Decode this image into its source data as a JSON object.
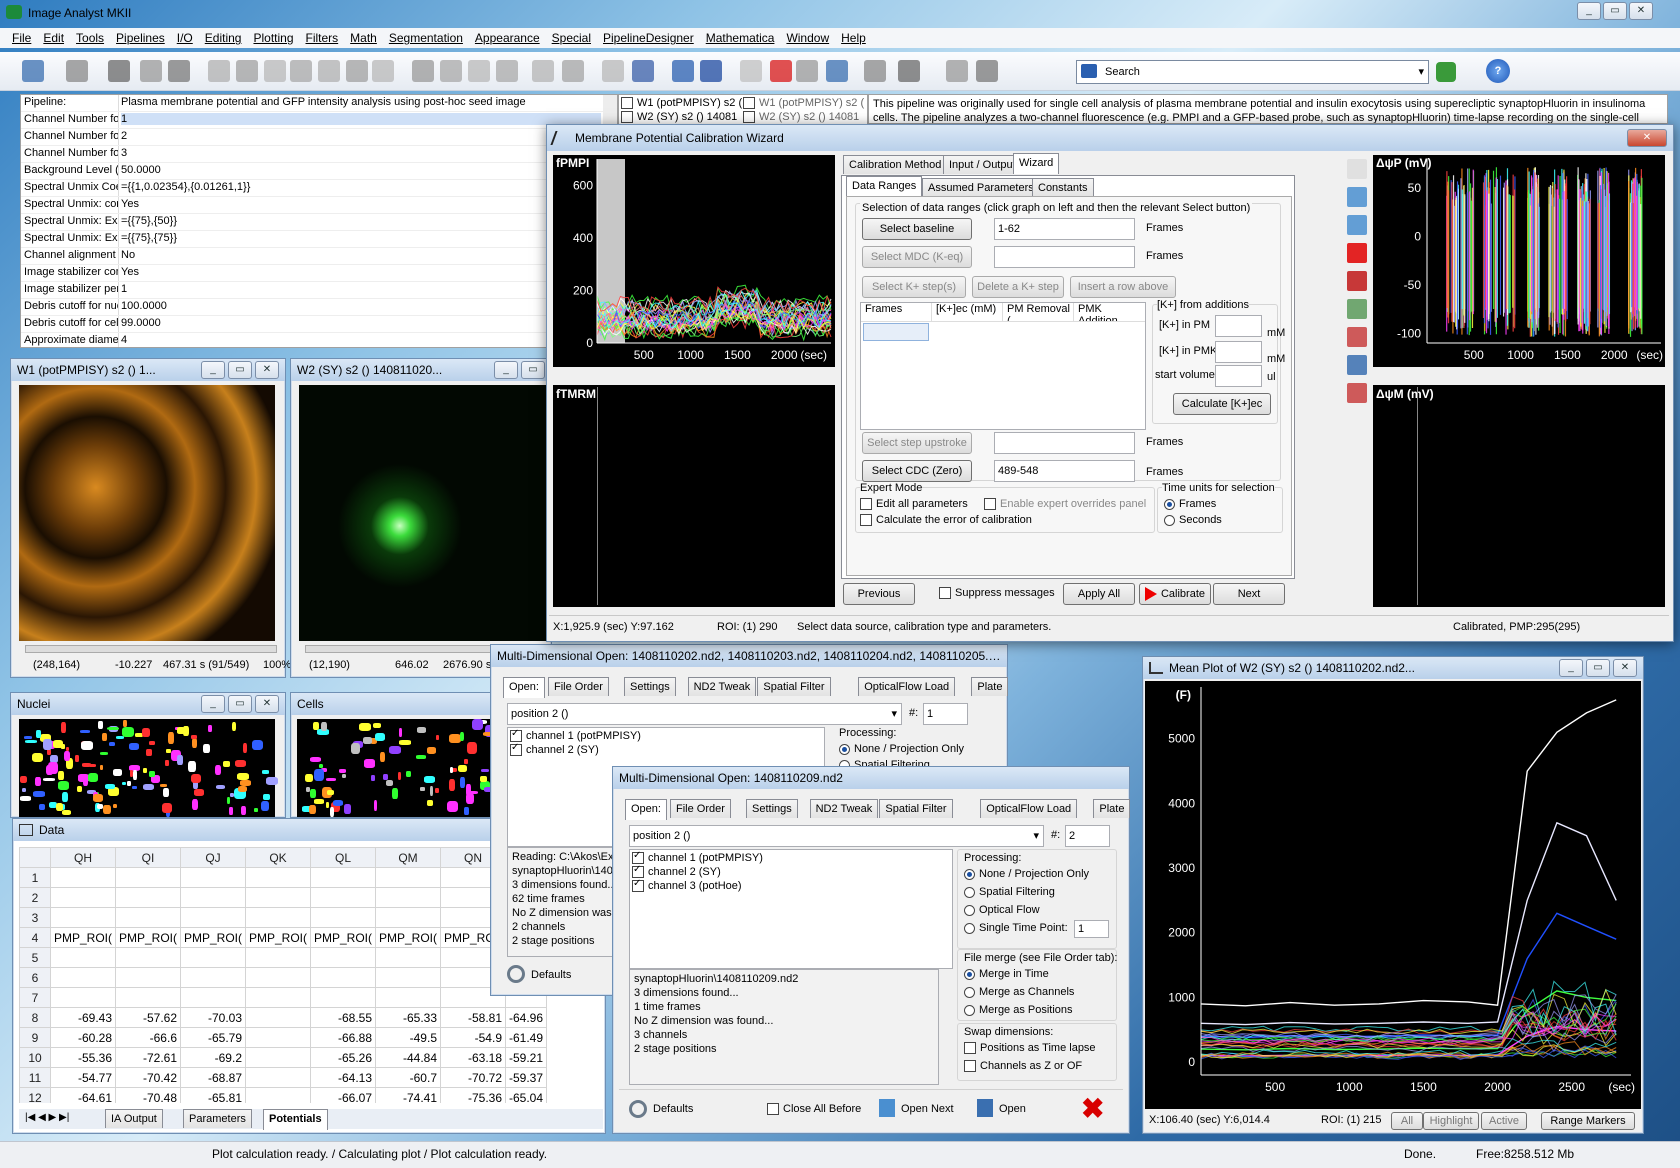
{
  "app": {
    "title": "Image Analyst MKII"
  },
  "menu": [
    "File",
    "Edit",
    "Tools",
    "Pipelines",
    "I/O",
    "Editing",
    "Plotting",
    "Filters",
    "Math",
    "Segmentation",
    "Appearance",
    "Special",
    "PipelineDesigner",
    "Mathematica",
    "Window",
    "Help"
  ],
  "search": {
    "placeholder": "Search"
  },
  "pipeline": {
    "rows": [
      {
        "k": "Pipeline:",
        "v": "Plasma membrane potential and GFP intensity analysis using post-hoc seed image"
      },
      {
        "k": "Channel Number for F",
        "v": "1"
      },
      {
        "k": "Channel Number for G",
        "v": "2"
      },
      {
        "k": "Channel Number for p",
        "v": "3"
      },
      {
        "k": "Background Level (Pe",
        "v": "50.0000"
      },
      {
        "k": "Spectral Unmix Coeff",
        "v": "={{1,0.02354},{0.01261,1}}"
      },
      {
        "k": "Spectral Unmix: corre",
        "v": "Yes"
      },
      {
        "k": "Spectral Unmix: Expo",
        "v": "={{75},{50}}"
      },
      {
        "k": "Spectral Unmix: Expo",
        "v": "={{75},{75}}"
      },
      {
        "k": "Channel alignment ba",
        "v": "No"
      },
      {
        "k": "Image stabilizer comp",
        "v": "Yes"
      },
      {
        "k": "Image stabilizer perio",
        "v": "1"
      },
      {
        "k": "Debris cutoff for nuc",
        "v": "100.0000"
      },
      {
        "k": "Debris cutoff for cell",
        "v": "99.0000"
      },
      {
        "k": "Approximate diamete",
        "v": "4"
      }
    ],
    "description": "This pipeline was originally used for single cell analysis of plasma membrane potential and insulin exocytosis using superecliptic synaptopHluorin in insulinoma cells. The pipeline analyzes a two-channel fluorescence (e.g. PMPI and a GFP-based probe, such as synaptopHluorin) time-lapse recording on the single-cell",
    "files": [
      "W1 (potPMPISY) s2 (",
      "W2 (SY) s2 () 14081",
      "W1 (potPMPISY) s2 (",
      "W2 (SY) s2 () 14081"
    ]
  },
  "img1": {
    "title": "W1 (potPMPISY) s2 () 1...",
    "coord": "(248,164)",
    "val": "-10.227",
    "time": "467.31 s (91/549)",
    "zoom": "100%"
  },
  "img2": {
    "title": "W2 (SY) s2 () 140811020...",
    "coord": "(12,190)",
    "val": "646.02",
    "time": "2676.90 s (471/5"
  },
  "nuclei": {
    "title": "Nuclei"
  },
  "cells": {
    "title": "Cells"
  },
  "wizard": {
    "title": "Membrane Potential Calibration Wizard",
    "tabs_top": [
      "Calibration Method",
      "Input / Output",
      "Wizard"
    ],
    "tabs_sub": [
      "Data Ranges",
      "Assumed Parameters",
      "Constants"
    ],
    "hint": "Selection of data ranges (click graph on left and then the relevant Select button)",
    "btn_baseline": "Select baseline",
    "baseline_val": "1-62",
    "frames": "Frames",
    "btn_mdc": "Select MDC (K-eq)",
    "btn_kstep": "Select K+ step(s)",
    "btn_delk": "Delete a K+ step",
    "btn_insert": "Insert a row above",
    "table_headers": [
      "Frames",
      "[K+]ec (mM)",
      "PM Removal (",
      "PMK Addition"
    ],
    "kadd_title": "[K+] from additions",
    "k_pm": "[K+] in PM",
    "k_pmk": "[K+] in PMK",
    "start_vol": "start volume",
    "mM": "mM",
    "ul": "ul",
    "btn_calc": "Calculate [K+]ec",
    "btn_upstroke": "Select step upstroke",
    "btn_cdc": "Select CDC (Zero)",
    "cdc_val": "489-548",
    "expert_title": "Expert Mode",
    "edit_all": "Edit all parameters",
    "enable_expert": "Enable expert overrides panel",
    "calc_err": "Calculate the error of calibration",
    "time_title": "Time units for selection",
    "opt_frames": "Frames",
    "opt_seconds": "Seconds",
    "btn_prev": "Previous",
    "suppress": "Suppress messages",
    "btn_apply": "Apply All",
    "btn_calibrate": "Calibrate",
    "btn_next": "Next",
    "status_xy": "X:1,925.9 (sec)  Y:97.162",
    "status_roi": "ROI: (1) 290",
    "status_msg": "Select data source, calibration type and parameters.",
    "status_right": "Calibrated, PMP:295(295)",
    "graph_fpmpi": "fPMPI",
    "graph_ftmrm": "fTMRM",
    "graph_dp": "ΔψP (mV)",
    "graph_dm": "ΔψM (mV)",
    "fpmpi_yticks": [
      "600",
      "400",
      "200",
      "0"
    ],
    "fpmpi_xticks": [
      "500",
      "1000",
      "1500",
      "2000"
    ],
    "sec": "(sec)",
    "dp_yticks": [
      "50",
      "0",
      "-50",
      "-100"
    ],
    "dp_xticks": [
      "500",
      "1000",
      "1500",
      "2000"
    ]
  },
  "mdo1": {
    "title": "Multi-Dimensional Open: 1408110202.nd2, 1408110203.nd2, 1408110204.nd2, 1408110205.nd2",
    "tabs": [
      "Open:",
      "File Order",
      "Settings",
      "ND2 Tweak",
      "Spatial Filter",
      "OpticalFlow Load",
      "Plate"
    ],
    "position": "position 2 ()",
    "pos_label": "#:",
    "pos_num": "1",
    "channels": [
      "channel 1 (potPMPISY)",
      "channel 2 (SY)"
    ],
    "processing": "Processing:",
    "proc_opt": "None / Projection Only",
    "proc_opt2": "Spatial Filtering",
    "log": [
      "Reading: C:\\Akos\\Exe",
      "synaptopHluorin\\1408",
      "3 dimensions found...",
      "62 time frames",
      "No Z dimension was",
      "2 channels",
      "2 stage positions"
    ],
    "defaults": "Defaults"
  },
  "mdo2": {
    "title": "Multi-Dimensional Open: 1408110209.nd2",
    "tabs": [
      "Open:",
      "File Order",
      "Settings",
      "ND2 Tweak",
      "Spatial Filter",
      "OpticalFlow Load",
      "Plate"
    ],
    "position": "position 2 ()",
    "pos_label": "#:",
    "pos_num": "2",
    "channels": [
      "channel 1 (potPMPISY)",
      "channel 2 (SY)",
      "channel 3 (potHoe)"
    ],
    "processing": "Processing:",
    "proc": [
      "None / Projection Only",
      "Spatial Filtering",
      "Optical Flow",
      "Single Time Point:"
    ],
    "stp": "1",
    "merge_title": "File merge (see File Order tab):",
    "merge": [
      "Merge in Time",
      "Merge as Channels",
      "Merge as Positions"
    ],
    "swap_title": "Swap dimensions:",
    "swap": [
      "Positions as Time lapse",
      "Channels as Z or OF"
    ],
    "log": [
      "synaptopHluorin\\1408110209.nd2",
      "3 dimensions found...",
      "1 time frames",
      "No Z dimension was found...",
      "3 channels",
      "2 stage positions"
    ],
    "defaults": "Defaults",
    "close_all": "Close All Before",
    "open_next": "Open Next",
    "open": "Open"
  },
  "data": {
    "title": "Data",
    "cols": [
      "QH",
      "QI",
      "QJ",
      "QK",
      "QL",
      "QM",
      "QN"
    ],
    "rows": [
      {
        "n": "1",
        "c": [
          "",
          "",
          "",
          "",
          "",
          "",
          "",
          ""
        ]
      },
      {
        "n": "2",
        "c": [
          "",
          "",
          "",
          "",
          "",
          "",
          "",
          ""
        ]
      },
      {
        "n": "3",
        "c": [
          "",
          "",
          "",
          "",
          "",
          "",
          "",
          ""
        ]
      },
      {
        "n": "4",
        "c": [
          "PMP_ROI(",
          "PMP_ROI(",
          "PMP_ROI(",
          "PMP_ROI(",
          "PMP_ROI(",
          "PMP_ROI(",
          "PMP_ROI(",
          ""
        ]
      },
      {
        "n": "5",
        "c": [
          "",
          "",
          "",
          "",
          "",
          "",
          "",
          ""
        ]
      },
      {
        "n": "6",
        "c": [
          "",
          "",
          "",
          "",
          "",
          "",
          "",
          ""
        ]
      },
      {
        "n": "7",
        "c": [
          "",
          "",
          "",
          "",
          "",
          "",
          "",
          ""
        ]
      },
      {
        "n": "8",
        "c": [
          "-69.43",
          "-57.62",
          "-70.03",
          "",
          "-68.55",
          "-65.33",
          "-58.81",
          "-64.96"
        ]
      },
      {
        "n": "9",
        "c": [
          "-60.28",
          "-66.6",
          "-65.79",
          "",
          "-66.88",
          "-49.5",
          "-54.9",
          "-61.49"
        ]
      },
      {
        "n": "10",
        "c": [
          "-55.36",
          "-72.61",
          "-69.2",
          "",
          "-65.26",
          "-44.84",
          "-63.18",
          "-59.21"
        ]
      },
      {
        "n": "11",
        "c": [
          "-54.77",
          "-70.42",
          "-68.87",
          "",
          "-64.13",
          "-60.7",
          "-70.72",
          "-59.37"
        ]
      },
      {
        "n": "12",
        "c": [
          "-64.61",
          "-70.48",
          "-65.81",
          "",
          "-66.07",
          "-74.41",
          "-75.36",
          "-65.04"
        ]
      }
    ],
    "sheets": [
      "IA Output",
      "Parameters",
      "Potentials"
    ]
  },
  "meanplot": {
    "title": "Mean Plot of W2 (SY) s2 () 1408110202.nd2...",
    "ylabel": "(F)",
    "yticks": [
      "5000",
      "4000",
      "3000",
      "2000",
      "1000",
      "0"
    ],
    "xticks": [
      "500",
      "1000",
      "1500",
      "2000",
      "2500"
    ],
    "xunit": "(sec)",
    "status_xy": "X:106.40 (sec)  Y:6,014.4",
    "status_roi": "ROI: (1) 215",
    "btns": [
      "All",
      "Highlight",
      "Active",
      "Range Markers"
    ]
  },
  "chart_data": [
    {
      "type": "line",
      "ylabel": "(F)",
      "xlabel": "(sec)",
      "xlim": [
        0,
        2900
      ],
      "ylim": [
        -200,
        5800
      ],
      "series": [
        {
          "x": [
            0,
            300,
            600,
            900,
            1200,
            1500,
            1800,
            2000,
            2200,
            2400,
            2600,
            2800
          ],
          "values": [
            900,
            870,
            920,
            880,
            900,
            950,
            930,
            880,
            4500,
            5100,
            5400,
            5600
          ]
        },
        {
          "x": [
            0,
            300,
            600,
            900,
            1200,
            1500,
            1800,
            2000,
            2200,
            2400,
            2600,
            2800
          ],
          "values": [
            600,
            580,
            610,
            590,
            600,
            620,
            600,
            620,
            2500,
            3700,
            3500,
            2500
          ]
        },
        {
          "x": [
            0,
            300,
            600,
            900,
            1200,
            1500,
            1800,
            2000,
            2200,
            2400,
            2600,
            2800
          ],
          "values": [
            400,
            380,
            410,
            390,
            400,
            420,
            400,
            420,
            1600,
            2300,
            2100,
            1900
          ]
        },
        {
          "x": [
            0,
            300,
            600,
            900,
            1200,
            1500,
            1800,
            2000,
            2200,
            2400,
            2600,
            2800
          ],
          "values": [
            200,
            190,
            210,
            195,
            200,
            215,
            205,
            210,
            800,
            1100,
            1000,
            950
          ]
        },
        {
          "x": [
            0,
            300,
            600,
            900,
            1200,
            1500,
            1800,
            2000,
            2200,
            2400,
            2600,
            2800
          ],
          "values": [
            100,
            95,
            105,
            100,
            100,
            110,
            105,
            110,
            400,
            550,
            500,
            480
          ]
        }
      ]
    }
  ],
  "status": {
    "left": "Plot calculation ready. / Calculating plot / Plot calculation ready.",
    "done": "Done.",
    "free": "Free:8258.512 Mb"
  }
}
